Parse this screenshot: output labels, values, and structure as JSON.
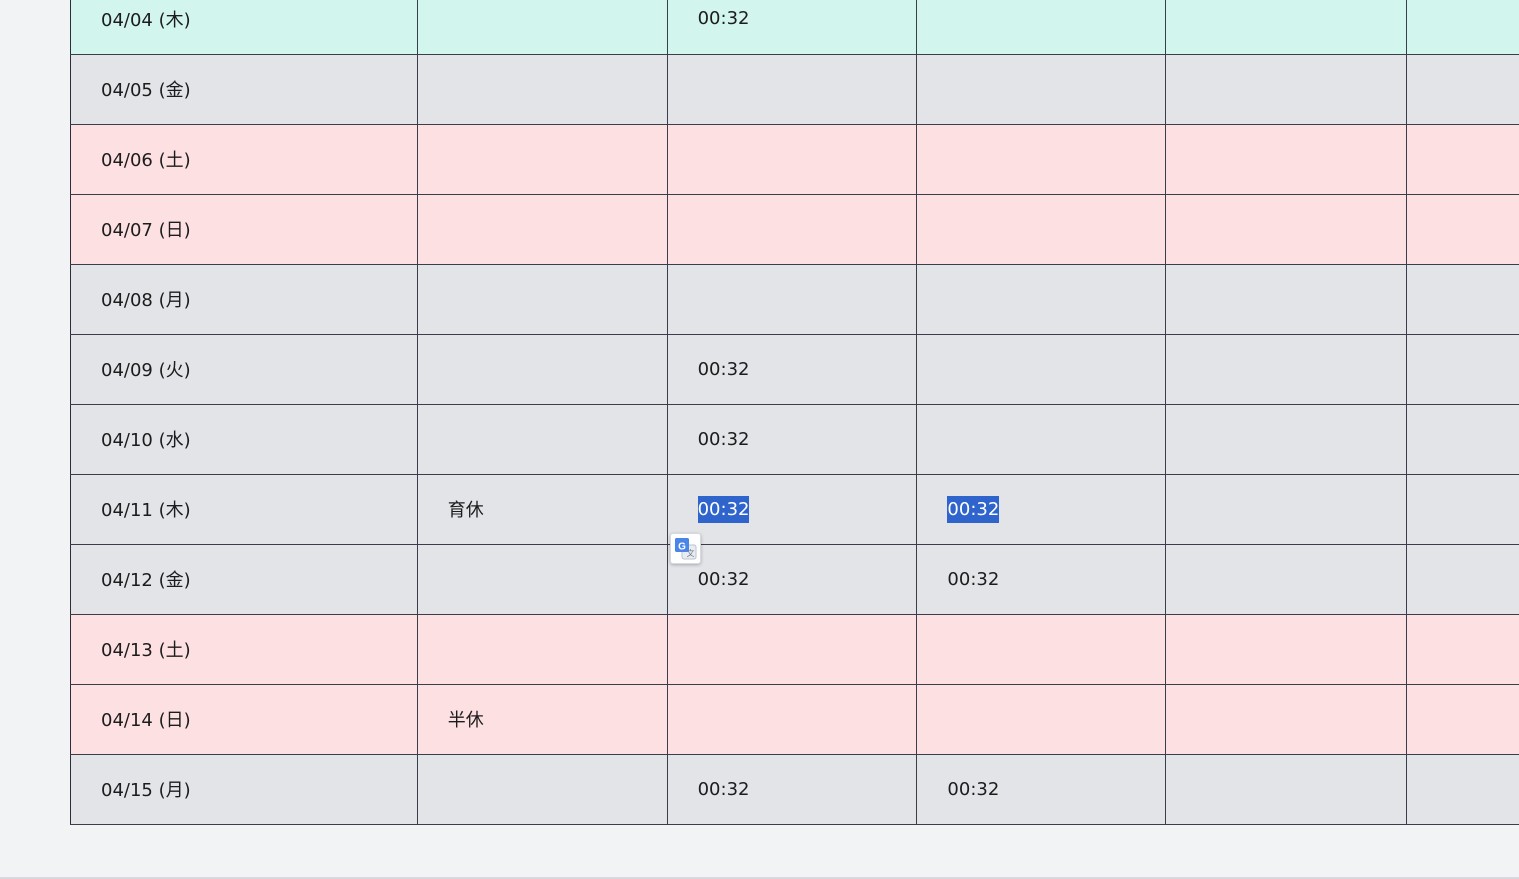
{
  "attendance_table": {
    "rows": [
      {
        "date": "04/04 (木)",
        "type": "today",
        "leave": "",
        "c1": "00:32",
        "c2": "",
        "c3": "",
        "c4": ""
      },
      {
        "date": "04/05 (金)",
        "type": "weekday",
        "leave": "",
        "c1": "",
        "c2": "",
        "c3": "",
        "c4": ""
      },
      {
        "date": "04/06 (土)",
        "type": "weekend",
        "leave": "",
        "c1": "",
        "c2": "",
        "c3": "",
        "c4": ""
      },
      {
        "date": "04/07 (日)",
        "type": "weekend",
        "leave": "",
        "c1": "",
        "c2": "",
        "c3": "",
        "c4": ""
      },
      {
        "date": "04/08 (月)",
        "type": "weekday",
        "leave": "",
        "c1": "",
        "c2": "",
        "c3": "",
        "c4": ""
      },
      {
        "date": "04/09 (火)",
        "type": "weekday",
        "leave": "",
        "c1": "00:32",
        "c2": "",
        "c3": "",
        "c4": ""
      },
      {
        "date": "04/10 (水)",
        "type": "weekday",
        "leave": "",
        "c1": "00:32",
        "c2": "",
        "c3": "",
        "c4": ""
      },
      {
        "date": "04/11 (木)",
        "type": "weekday",
        "leave": "育休",
        "c1": "00:32",
        "c2": "00:32",
        "c3": "",
        "c4": ""
      },
      {
        "date": "04/12 (金)",
        "type": "weekday",
        "leave": "",
        "c1": "00:32",
        "c2": "00:32",
        "c3": "",
        "c4": ""
      },
      {
        "date": "04/13 (土)",
        "type": "weekend",
        "leave": "",
        "c1": "",
        "c2": "",
        "c3": "",
        "c4": ""
      },
      {
        "date": "04/14 (日)",
        "type": "weekend",
        "leave": "半休",
        "c1": "",
        "c2": "",
        "c3": "",
        "c4": ""
      },
      {
        "date": "04/15 (月)",
        "type": "weekday",
        "leave": "",
        "c1": "00:32",
        "c2": "00:32",
        "c3": "",
        "c4": ""
      }
    ]
  },
  "colors": {
    "today_row": "#d2f5ee",
    "weekday_row": "#e3e4e8",
    "weekend_row": "#fde0e2",
    "selection": "#2e64cc"
  },
  "selection": {
    "row": "04/11 (木)",
    "columns": [
      "c1",
      "c2"
    ]
  },
  "translate_popup": {
    "icon": "google-translate-icon"
  }
}
